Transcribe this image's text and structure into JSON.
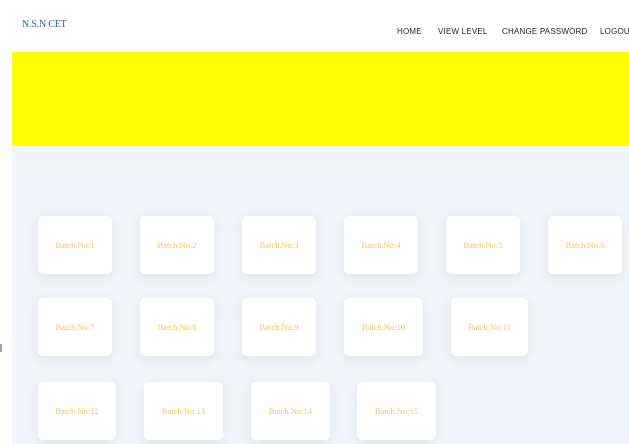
{
  "brand": "N.S.N CET",
  "nav": {
    "home": "HOME",
    "view_level": "VIEW LEVEL",
    "change_password": "CHANGE PASSWORD",
    "logout": "LOGOU"
  },
  "colors": {
    "hero": "#ffff00",
    "batch_text": "#f2c463",
    "brand": "#2b5fa8"
  },
  "batches": [
    "Batch.No:1",
    "Batch.No:2",
    "Batch.No:3",
    "Batch.No:4",
    "Batch.No:5",
    "Batch.No:6",
    "Batch.No:7",
    "Batch.No:8",
    "Batch.No:9",
    "Batch.No:10",
    "Batch.No:11",
    "Batch.No:12",
    "Batch.No:13",
    "Batch.No:14",
    "Batch.No:15"
  ]
}
